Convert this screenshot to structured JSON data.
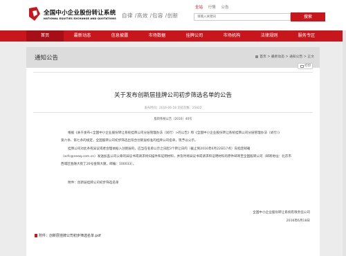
{
  "brand": {
    "name_cn": "全国中小企业股份转让系统",
    "name_en": "NATIONAL EQUITIES EXCHANGE AND QUOTATIONS",
    "slogan": "自律 /高效 /包容 /创新"
  },
  "top_links": {
    "items": [
      "全站",
      "行情",
      "公告"
    ]
  },
  "search": {
    "placeholder": "请输入关键词",
    "button_label": "搜索"
  },
  "nav": {
    "items": [
      "首页",
      "最新动态",
      "信息披露",
      "市场数据",
      "挂牌公司",
      "市场机构",
      "法律规则",
      "服务专区"
    ]
  },
  "section": {
    "title": "通知公告",
    "breadcrumb": "首页 > 最新动态 > 通知公告 > 正文"
  },
  "article": {
    "print_label": "打印",
    "title": "关于发布创新层挂牌公司初步筛选名单的公告",
    "meta": "发布时间：2016-06-18 浏览次数：25822",
    "doc_no": "股转系统公告〔2016〕40号",
    "paragraphs": [
      "根据《关于发布<全国中小企业股份转让系统挂牌公司分层管理办法（试行）>的公告》和《全国中小企业股份转让系统挂牌公司分层管理办法（试行）》",
      "第六条、第七条的规定，全国股转公司初步筛选出符合创新层标准的挂牌公司名单，现予以公示。",
      "挂牌公司对此条有异议或者合理依据入创新层的，应当在名单公示之日起3个转让日内（截止到2016年6月22日17点）向指定邮箱",
      "（xcfc@neeq.com.cn）发送加盖公司公章的异议书或请求将扫描件和证明材料，并及时将异议书或请求和证明材料的原件邮寄至全国股转公司（邮寄地址：北京市",
      "西城区金融大街丁26号金阳大厦，邮编：100033）。"
    ],
    "attachment_note": "附件：创新层挂牌公司初步筛选名单",
    "signature_org": "全国中小企业股份转让系统有限责任公司",
    "signature_date": "2016年6月18日",
    "attachment_link": "附件：创新层挂牌公司初步筛选名单.pdf"
  },
  "colors": {
    "accent": "#c8161d",
    "nav_active": "#a50f15",
    "page_bg": "#ececec",
    "section_bar": "#dcdcdc"
  }
}
